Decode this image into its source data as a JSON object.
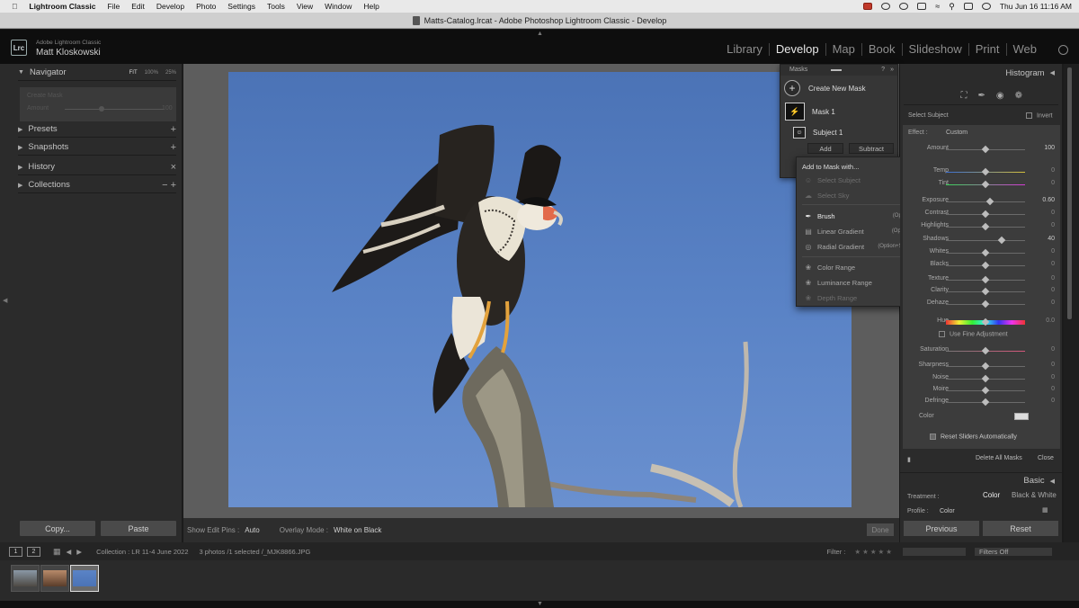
{
  "menubar": {
    "app": "Lightroom Classic",
    "items": [
      "File",
      "Edit",
      "Develop",
      "Photo",
      "Settings",
      "Tools",
      "View",
      "Window",
      "Help"
    ],
    "clock": "Thu Jun 16  11:16 AM"
  },
  "window": {
    "title": "Matts-Catalog.lrcat - Adobe Photoshop Lightroom Classic - Develop"
  },
  "identity": {
    "logo": "Lrc",
    "product": "Adobe Lightroom Classic",
    "user": "Matt Kloskowski"
  },
  "modules": [
    {
      "label": "Library"
    },
    {
      "label": "Develop",
      "active": true
    },
    {
      "label": "Map"
    },
    {
      "label": "Book"
    },
    {
      "label": "Slideshow"
    },
    {
      "label": "Print"
    },
    {
      "label": "Web"
    }
  ],
  "left_panel": {
    "navigator": "Navigator",
    "nav_zoom": [
      "FIT",
      "100%",
      "25%"
    ],
    "nav_preview_lines": [
      "Create Mask",
      "Amount",
      "100"
    ],
    "presets": "Presets",
    "snapshots": "Snapshots",
    "history": "History",
    "collections": "Collections",
    "copy_button": "Copy...",
    "paste_button": "Paste"
  },
  "toolbar": {
    "edit_pins_label": "Show Edit Pins :",
    "edit_pins_value": "Auto",
    "overlay_label": "Overlay Mode :",
    "overlay_value": "White on Black",
    "done": "Done"
  },
  "masks_panel": {
    "title": "Masks",
    "create_new": "Create New Mask",
    "mask1": "Mask 1",
    "subject1": "Subject 1",
    "add": "Add",
    "subtract": "Subtract"
  },
  "dropdown": {
    "header": "Add to Mask with...",
    "items": [
      {
        "label": "Select Subject",
        "shortcut": "",
        "state": "dim"
      },
      {
        "label": "Select Sky",
        "shortcut": "",
        "state": "dim"
      },
      {
        "label": "Brush",
        "shortcut": "(Option+K)",
        "state": "highlight"
      },
      {
        "label": "Linear Gradient",
        "shortcut": "(Option+M)",
        "state": "normal"
      },
      {
        "label": "Radial Gradient",
        "shortcut": "(Option+Shift+M)",
        "state": "normal"
      },
      {
        "label": "Color Range",
        "shortcut": "",
        "state": "normal"
      },
      {
        "label": "Luminance Range",
        "shortcut": "",
        "state": "normal"
      },
      {
        "label": "Depth Range",
        "shortcut": "",
        "state": "dim"
      }
    ]
  },
  "right_panel": {
    "histogram": "Histogram",
    "select_subject": "Select Subject",
    "invert": "Invert",
    "effect_label": "Effect :",
    "effect_value": "Custom",
    "amount_label": "Amount",
    "amount_value": "100",
    "sliders": [
      {
        "label": "Temp",
        "value": "0",
        "pos": 0.5
      },
      {
        "label": "Tint",
        "value": "0",
        "pos": 0.5
      },
      {
        "label": "Exposure",
        "value": "0.60",
        "pos": 0.56
      },
      {
        "label": "Contrast",
        "value": "0",
        "pos": 0.5
      },
      {
        "label": "Highlights",
        "value": "0",
        "pos": 0.5
      },
      {
        "label": "Shadows",
        "value": "40",
        "pos": 0.7
      },
      {
        "label": "Whites",
        "value": "0",
        "pos": 0.5
      },
      {
        "label": "Blacks",
        "value": "0",
        "pos": 0.5
      },
      {
        "label": "Texture",
        "value": "0",
        "pos": 0.5
      },
      {
        "label": "Clarity",
        "value": "0",
        "pos": 0.5
      },
      {
        "label": "Dehaze",
        "value": "0",
        "pos": 0.5
      },
      {
        "label": "Hue",
        "value": "0.0",
        "pos": 0.5
      },
      {
        "label": "Saturation",
        "value": "0",
        "pos": 0.5
      },
      {
        "label": "Sharpness",
        "value": "0",
        "pos": 0.5
      },
      {
        "label": "Noise",
        "value": "0",
        "pos": 0.5
      },
      {
        "label": "Moire",
        "value": "0",
        "pos": 0.5
      },
      {
        "label": "Defringe",
        "value": "0",
        "pos": 0.5
      }
    ],
    "fine_adjust": "Use Fine Adjustment",
    "color_label": "Color",
    "reset_sliders": "Reset Sliders Automatically",
    "delete_all": "Delete All Masks",
    "close": "Close",
    "basic": "Basic",
    "treatment_label": "Treatment :",
    "treatment_color": "Color",
    "treatment_bw": "Black & White",
    "profile_label": "Profile :",
    "profile_value": "Color",
    "previous": "Previous",
    "reset": "Reset"
  },
  "filmbar": {
    "monitor1": "1",
    "monitor2": "2",
    "collection": "Collection : LR 11-4 June 2022",
    "count": "3 photos /1 selected /_MJK8866.JPG",
    "filter_label": "Filter :",
    "filters_off": "Filters Off"
  },
  "colors": {
    "accent": "#e8e8e8",
    "panel": "#2b2b2b",
    "sky": "#5a83c6"
  }
}
